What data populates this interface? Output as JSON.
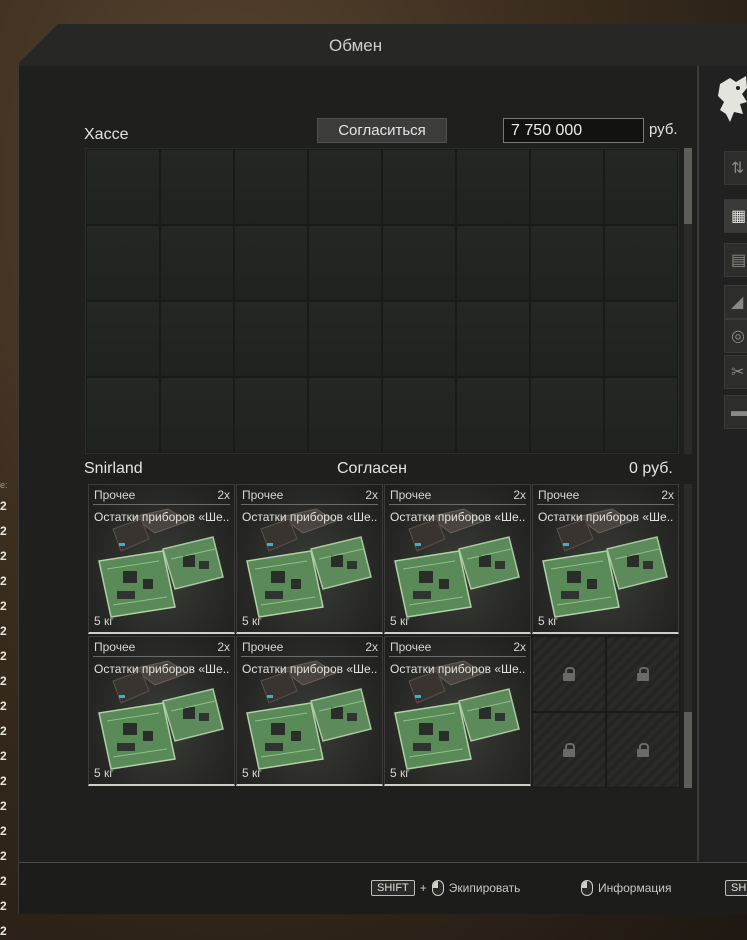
{
  "left_list": {
    "label": "e:",
    "values": [
      "2",
      "2",
      "2",
      "2",
      "2",
      "2",
      "2",
      "2",
      "2",
      "2",
      "2",
      "2",
      "2",
      "2",
      "2",
      "2",
      "2",
      "2"
    ]
  },
  "window": {
    "title": "Обмен"
  },
  "trader": {
    "name": "Хассе",
    "accept_label": "Согласиться",
    "price_value": "7 750 000",
    "currency": "руб."
  },
  "player": {
    "name": "Snirland",
    "status": "Согласен",
    "sum": "0 руб."
  },
  "items": [
    {
      "category": "Прочее",
      "qty": "2x",
      "name": "Остатки приборов «Ше..",
      "weight": "5 кг"
    },
    {
      "category": "Прочее",
      "qty": "2x",
      "name": "Остатки приборов «Ше..",
      "weight": "5 кг"
    },
    {
      "category": "Прочее",
      "qty": "2x",
      "name": "Остатки приборов «Ше..",
      "weight": "5 кг"
    },
    {
      "category": "Прочее",
      "qty": "2x",
      "name": "Остатки приборов «Ше..",
      "weight": "5 кг"
    },
    {
      "category": "Прочее",
      "qty": "2x",
      "name": "Остатки приборов «Ше..",
      "weight": "5 кг"
    },
    {
      "category": "Прочее",
      "qty": "2x",
      "name": "Остатки приборов «Ше..",
      "weight": "5 кг"
    },
    {
      "category": "Прочее",
      "qty": "2x",
      "name": "Остатки приборов «Ше..",
      "weight": "5 кг"
    }
  ],
  "footer": {
    "shift_key": "SHIFT",
    "plus": "+",
    "equip_label": "Экипировать",
    "info_label": "Информация",
    "shift_key_2": "SH"
  }
}
